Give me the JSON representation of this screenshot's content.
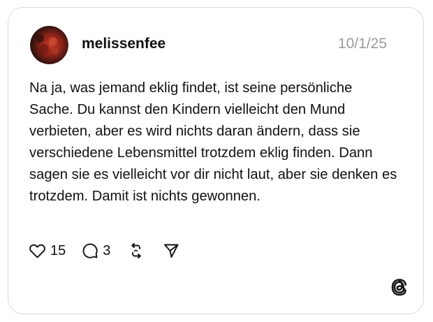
{
  "post": {
    "username": "melissenfee",
    "date": "10/1/25",
    "text": "Na ja, was jemand eklig findet, ist seine persönliche Sache. Du kannst den Kindern vielleicht den Mund verbieten, aber es wird nichts daran ändern, dass sie verschiedene Lebensmittel trotzdem eklig finden. Dann sagen sie es vielleicht vor dir nicht laut, aber sie denken es trotzdem. Damit ist nichts gewonnen."
  },
  "actions": {
    "likes": "15",
    "replies": "3",
    "like_icon": "heart-icon",
    "reply_icon": "comment-icon",
    "repost_icon": "repost-icon",
    "share_icon": "send-icon"
  },
  "branding": {
    "logo_icon": "threads-logo-icon"
  },
  "colors": {
    "border": "#d9d9d9",
    "text": "#111111",
    "muted": "#9a9a9a"
  }
}
